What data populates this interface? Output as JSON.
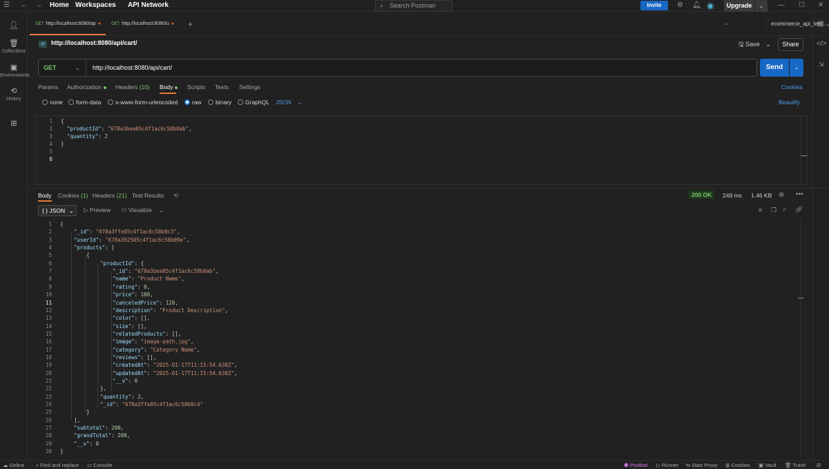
{
  "topbar": {
    "home": "Home",
    "workspaces": "Workspaces",
    "api_network": "API Network",
    "search_placeholder": "Search Postman",
    "invite": "Invite",
    "upgrade": "Upgrade"
  },
  "sidebar": {
    "items": [
      {
        "label": "",
        "icon": "user-icon"
      },
      {
        "label": "Collections",
        "icon": "collections-icon"
      },
      {
        "label": "Environments",
        "icon": "environments-icon"
      },
      {
        "label": "History",
        "icon": "history-icon"
      },
      {
        "label": "",
        "icon": "apps-icon"
      }
    ]
  },
  "tabs": [
    {
      "method": "GET",
      "title": "http://localhost:8080/ap"
    },
    {
      "method": "GET",
      "title": "http://localhost:8080/u"
    }
  ],
  "environment": "ecommerce_api_testi...",
  "request": {
    "title": "http://localhost:8080/api/cart/",
    "save": "Save",
    "share": "Share",
    "method": "GET",
    "url": "http://localhost:8080/api/cart/",
    "send": "Send"
  },
  "request_tabs": {
    "params": "Params",
    "authorization": "Authorization",
    "headers": "Headers",
    "headers_count": "(10)",
    "body": "Body",
    "scripts": "Scripts",
    "tests": "Tests",
    "settings": "Settings",
    "cookies": "Cookies"
  },
  "body_types": {
    "none": "none",
    "form_data": "form-data",
    "urlencoded": "x-www-form-urlencoded",
    "raw": "raw",
    "binary": "binary",
    "graphql": "GraphQL",
    "json": "JSON",
    "beautify": "Beautify"
  },
  "request_body": {
    "line_numbers": [
      "1",
      "2",
      "3",
      "4",
      "5",
      "6"
    ],
    "product_id_key": "\"productId\"",
    "product_id_val": "\"678a3bea05c4f1ac6c58b0ab\"",
    "quantity_key": "\"quantity\"",
    "quantity_val": "2"
  },
  "response_tabs": {
    "body": "Body",
    "cookies": "Cookies",
    "cookies_count": "(1)",
    "headers": "Headers",
    "headers_count": "(21)",
    "test_results": "Test Results",
    "status": "200 OK",
    "time": "249 ms",
    "size": "1.46 KB",
    "format": "JSON",
    "preview": "Preview",
    "visualize": "Visualize"
  },
  "response_body": {
    "_id": "\"678a3ffe05c4f1ac6c58b0c3\"",
    "userId": "\"678a392505c4f1ac6c58b09e\"",
    "product": {
      "_id": "\"678a3bea05c4f1ac6c58b0ab\"",
      "name": "\"Product Name\"",
      "rating": "0",
      "price": "100",
      "canceledPrice": "120",
      "description": "\"Product Description\"",
      "color": "[]",
      "size": "[]",
      "relatedProducts": "[]",
      "image": "\"image-path.jpg\"",
      "category": "\"Category Name\"",
      "reviews": "[]",
      "createdAt": "\"2025-01-17T11:15:54.638Z\"",
      "updatedAt": "\"2025-01-17T11:15:54.638Z\"",
      "__v": "0"
    },
    "quantity": "2",
    "item_id": "\"678a3ffe05c4f1ac6c58b0c4\"",
    "subtotal": "200",
    "grandTotal": "200",
    "__v": "0"
  },
  "statusbar": {
    "online": "Online",
    "find_replace": "Find and replace",
    "console": "Console",
    "postbot": "Postbot",
    "runner": "Runner",
    "start_proxy": "Start Proxy",
    "cookies": "Cookies",
    "vault": "Vault",
    "trash": "Trash"
  },
  "colors": {
    "accent": "#1767c4",
    "get_method": "#7bc46f",
    "tab_underline": "#ea7b3a",
    "link": "#4c9bf1"
  }
}
